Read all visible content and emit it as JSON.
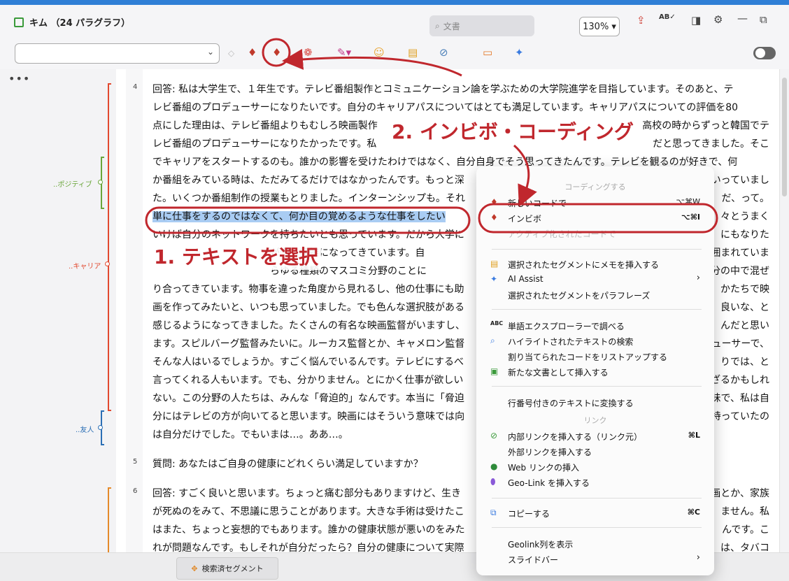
{
  "window": {
    "title": "キム （24 パラグラフ）"
  },
  "search": {
    "placeholder": "文書"
  },
  "zoom": {
    "value": "130%"
  },
  "colors": {
    "accent": "#2f7fd6",
    "highlight": "#a9ccf3",
    "callout": "#c0272d"
  },
  "codes": [
    {
      "label": "..ポジティブ",
      "color": "#6aa63a"
    },
    {
      "label": "..キャリア",
      "color": "#e2492f"
    },
    {
      "label": "..友人",
      "color": "#2b6fb5"
    }
  ],
  "paragraphs": [
    {
      "num": "4",
      "lines": [
        "回答: 私は大学生で、１年生です。テレビ番組製作とコミュニケーション論を学ぶための大学院進学を目指しています。そのあと、テ",
        "レビ番組のプロデューサーになりたいです。自分のキャリアパスについてはとても満足しています。キャリアパスについての評価を80",
        "点にした理由は、テレビ番組よりもむしろ映画製作",
        "レビ番組のプロデューサーになりたかったです。私",
        "でキャリアをスタートするのも。誰かの影響を受けたわけではなく、自分自身でそう思ってきたんです。テレビを観るのが好きで、何",
        "か番組をみている時は、ただみてるだけではなかったんです。もっと深",
        "た。いくつか番組制作の授業もとりました。インターンシップも。それ",
        "",
        "いけば自分のネットワークを持ちたいとも思っています。だから大学に",
        "　　　　　　　　　　　　が少し複雑になってきています。自",
        "　　　　　　　　　　　　らゆる種類のマスコミ分野のことに",
        "り合ってきています。物事を違った角度から見れるし、他の仕事にも助",
        "画を作ってみたいと、いつも思っていました。でも色んな選択肢がある",
        "感じるようになってきました。たくさんの有名な映画監督がいますし、",
        "ます。スピルバーグ監督みたいに。ルーカス監督とか、キャメロン監督",
        "そんな人はいるでしょうか。すごく悩んでいるんです。テレビにするべ",
        "言ってくれる人もいます。でも、分かりません。とにかく仕事が欲しい",
        "ない。この分野の人たちは、みんな「脅迫的」なんです。本当に「脅迫",
        "分にはテレビの方が向いてると思います。映画にはそういう意味では向",
        "は自分だけでした。でもいまは…。ああ…。"
      ],
      "selected": "単に仕事をするのではなくて、何か目の覚めるような仕事をしたい",
      "right_fragments": [
        "高校の時からずっと韓国でテ",
        "だと思ってきました。そこ",
        "いっていまし",
        "だ、って。",
        "々とうまく",
        "にもなりた",
        "囲まれていま",
        "分の中で混ぜ",
        "かたちで映",
        "良いな、と",
        "んだと思い",
        "ューサーで、",
        "りでは、と",
        "ざるかもしれ",
        "味で、私は自",
        "持っていたの"
      ]
    },
    {
      "num": "5",
      "lines": [
        "質問: あなたはご自身の健康にどれくらい満足していますか？"
      ]
    },
    {
      "num": "6",
      "lines": [
        "回答: すごく良いと思います。ちょっと痛む部分もありますけど、生き",
        "が死ぬのをみて、不思議に思うことがあります。大きな手術は受けたこ",
        "はまた、ちょっと妄想的でもあります。誰かの健康状態が悪いのをみた",
        "れが問題なんです。もしそれが自分だったら？自分の健康について実際"
      ],
      "right_fragments": [
        "画とか、家族",
        "ません。私",
        "んです。こ",
        "は、タバコ"
      ]
    }
  ],
  "callouts": {
    "step1": "1. テキストを選択",
    "step2": "2. インビボ・コーディング"
  },
  "context_menu": {
    "header_coding": "コーディングする",
    "new_code": "新しいコードで",
    "new_code_shortcut": "⌥⌘W",
    "invivo": "インビボ",
    "invivo_shortcut": "⌥⌘I",
    "active_code": "アクティブ化されたコードで",
    "insert_memo": "選択されたセグメントにメモを挿入する",
    "ai_assist": "AI Assist",
    "paraphrase": "選択されたセグメントをパラフレーズ",
    "word_explorer": "単語エクスプローラーで調べる",
    "search_highlighted": "ハイライトされたテキストの検索",
    "list_codes": "割り当てられたコードをリストアップする",
    "insert_as_doc": "新たな文書として挿入する",
    "convert_numbered": "行番号付きのテキストに変換する",
    "header_link": "リンク",
    "internal_link": "内部リンクを挿入する（リンク元）",
    "internal_link_shortcut": "⌘L",
    "external_link": "外部リンクを挿入する",
    "web_link": "Web リンクの挿入",
    "geo_link": "Geo-Link を挿入する",
    "copy": "コピーする",
    "copy_shortcut": "⌘C",
    "geolink_col": "Geolink列を表示",
    "slidebar": "スライドバー"
  },
  "bottom_bar": {
    "retrieved_segments": "検索済セグメント"
  }
}
